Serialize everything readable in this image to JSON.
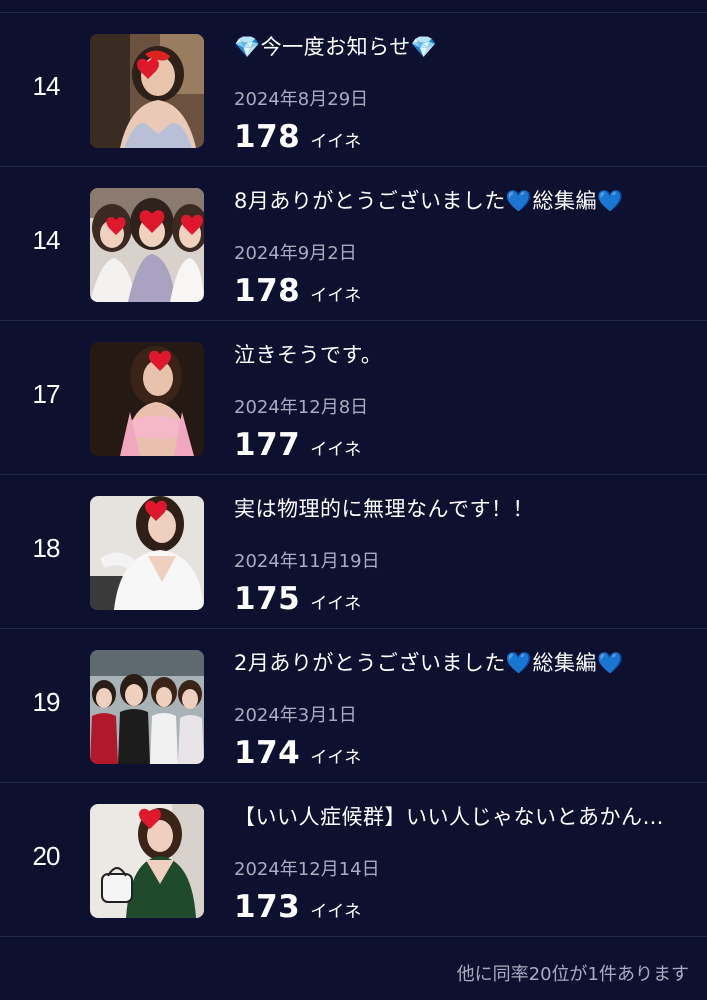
{
  "ranking": {
    "likes_unit": "イイネ",
    "entries": [
      {
        "rank": "14",
        "title": "💎今一度お知らせ💎",
        "date": "2024年8月29日",
        "likes": "178"
      },
      {
        "rank": "14",
        "title": "8月ありがとうございました💙総集編💙",
        "date": "2024年9月2日",
        "likes": "178"
      },
      {
        "rank": "17",
        "title": "泣きそうです。",
        "date": "2024年12月8日",
        "likes": "177"
      },
      {
        "rank": "18",
        "title": "実は物理的に無理なんです！！",
        "date": "2024年11月19日",
        "likes": "175"
      },
      {
        "rank": "19",
        "title": "2月ありがとうございました💙総集編💙",
        "date": "2024年3月1日",
        "likes": "174"
      },
      {
        "rank": "20",
        "title": "【いい人症候群】いい人じゃないとあかん…",
        "date": "2024年12月14日",
        "likes": "173"
      }
    ]
  },
  "footer": {
    "note": "他に同率20位が1件あります"
  },
  "colors": {
    "background": "#0e1030",
    "divider": "#22264a",
    "muted_text": "#a9acbf",
    "heart": "#e0182e"
  }
}
